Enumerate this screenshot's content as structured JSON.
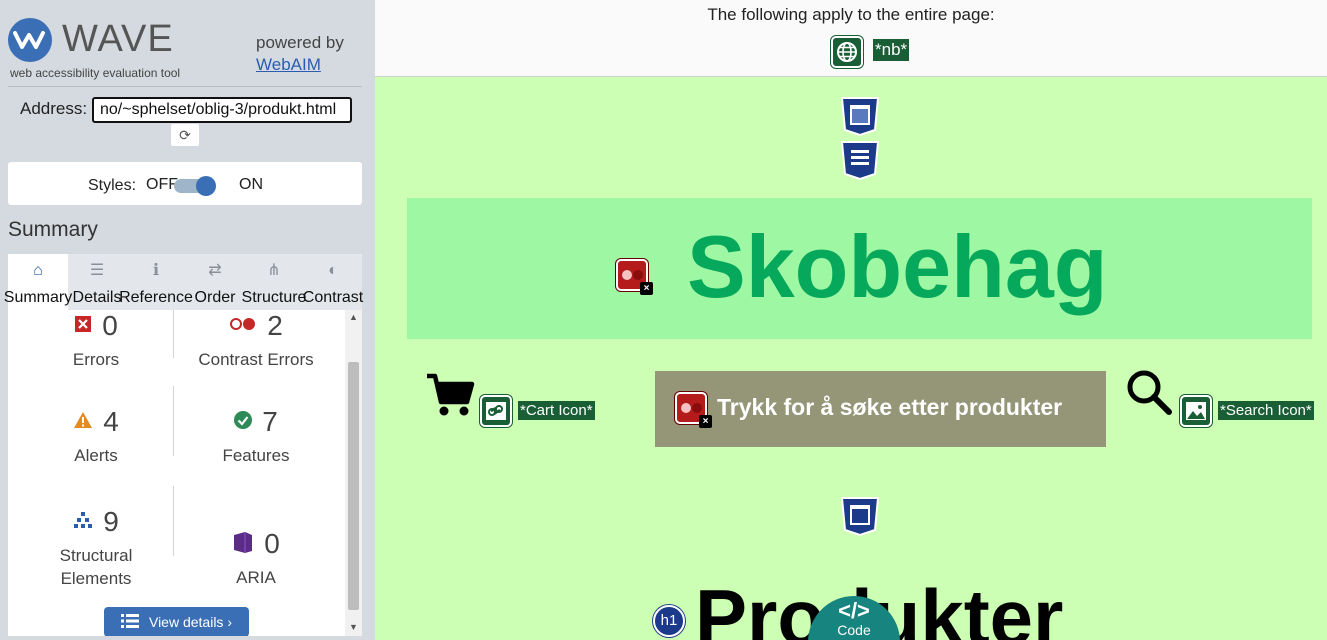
{
  "sidebar": {
    "logo_text": "WAVE",
    "logo_subtitle": "web accessibility evaluation tool",
    "powered_by": "powered by",
    "webaim_link": "WebAIM",
    "address_label": "Address:",
    "address_value": "no/~sphelset/oblig-3/produkt.html",
    "refresh_icon": "⟳",
    "styles_label": "Styles:",
    "styles_off": "OFF",
    "styles_on": "ON",
    "summary_title": "Summary",
    "tabs": [
      {
        "label": "Summary",
        "icon": "home-icon",
        "glyph": "⌂"
      },
      {
        "label": "Details",
        "icon": "list-icon",
        "glyph": "☰"
      },
      {
        "label": "Reference",
        "icon": "info-icon",
        "glyph": "ℹ"
      },
      {
        "label": "Order",
        "icon": "order-icon",
        "glyph": "⇄"
      },
      {
        "label": "Structure",
        "icon": "structure-icon",
        "glyph": "⋔"
      },
      {
        "label": "Contrast",
        "icon": "contrast-icon",
        "glyph": "◐"
      }
    ],
    "summary": {
      "errors": {
        "count": "0",
        "label": "Errors"
      },
      "contrast_errors": {
        "count": "2",
        "label": "Contrast Errors"
      },
      "alerts": {
        "count": "4",
        "label": "Alerts"
      },
      "features": {
        "count": "7",
        "label": "Features"
      },
      "structural": {
        "count": "9",
        "label": "Structural Elements"
      },
      "aria": {
        "count": "0",
        "label": "ARIA"
      }
    },
    "view_details": "View details ›"
  },
  "page": {
    "banner_text": "The following apply to the entire page:",
    "lang_tag": "*nb*",
    "heading": "Skobehag",
    "cart_tag": "*Cart Icon*",
    "search_button": "Trykk for å søke etter produkter",
    "search_tag": "*Search Icon*",
    "subheading": "Produkter",
    "h1_badge": "h1",
    "code_symbol": "</>",
    "code_label": "Code"
  },
  "colors": {
    "wave_blue": "#3a6fb5",
    "page_bg": "#ccffb3",
    "heading_green": "#06a85b",
    "feature_green": "#1a5e36",
    "error_red": "#b41c1c"
  }
}
